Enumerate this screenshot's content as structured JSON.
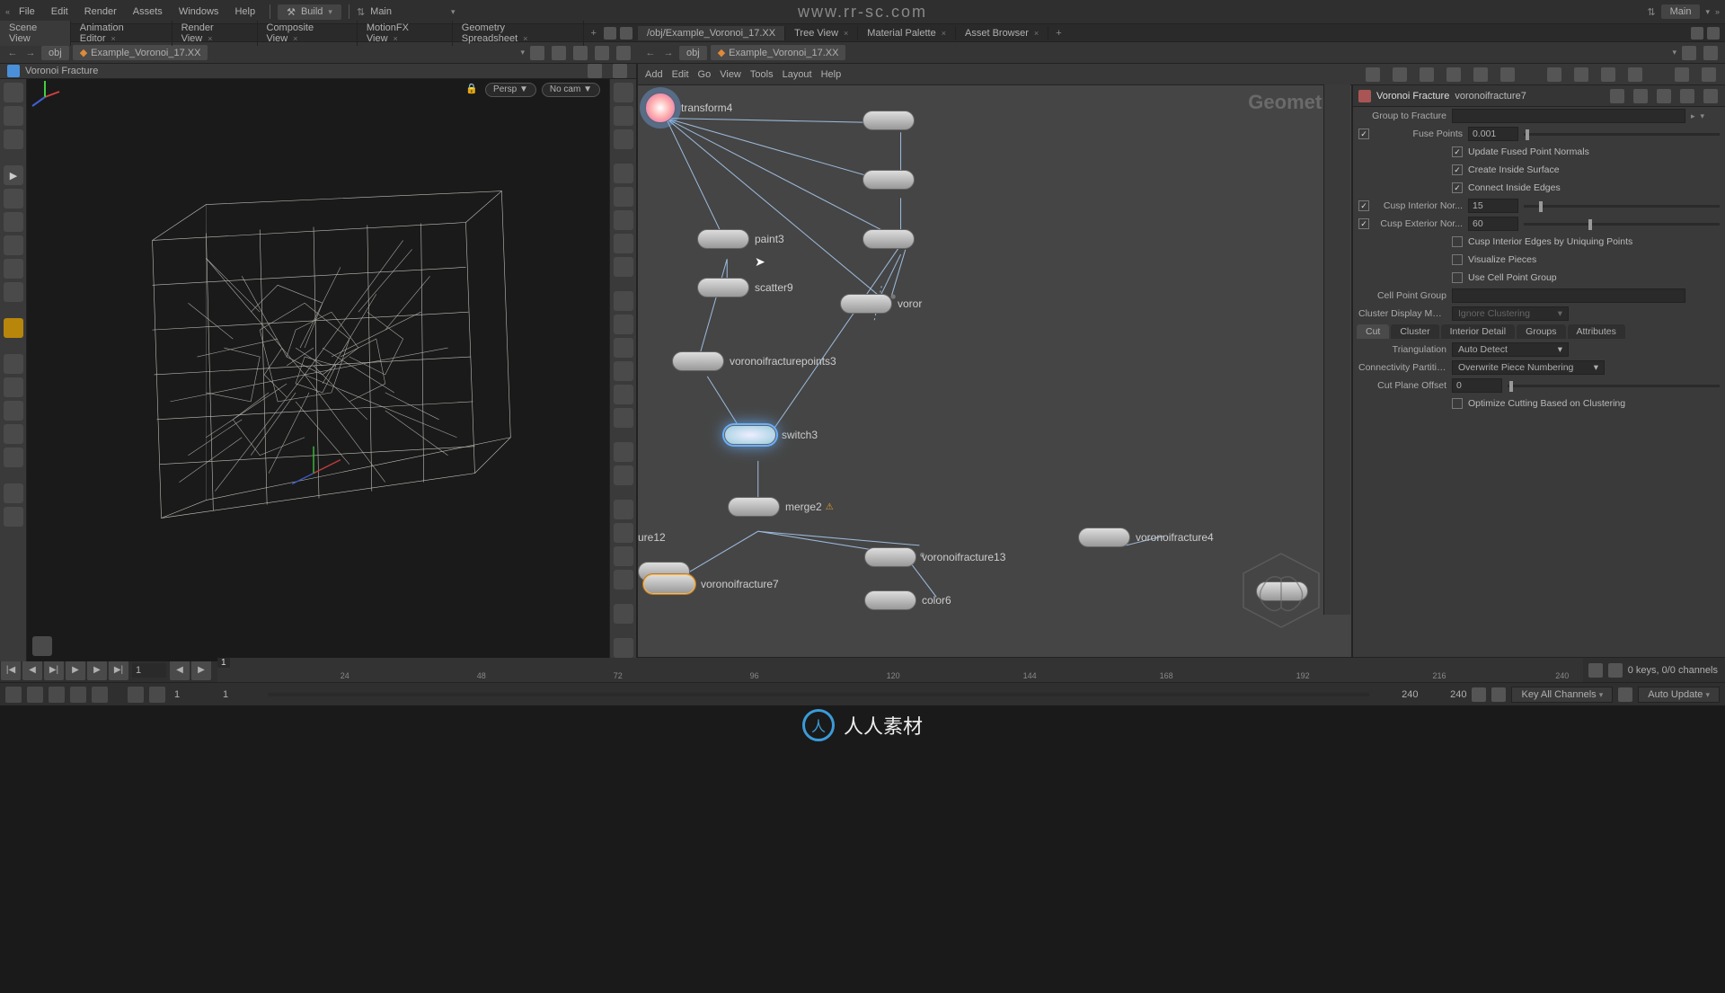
{
  "watermark": "www.rr-sc.com",
  "menubar": {
    "items": [
      "File",
      "Edit",
      "Render",
      "Assets",
      "Windows",
      "Help"
    ],
    "build": "Build",
    "main": "Main",
    "main_right": "Main"
  },
  "left_tabs": [
    "Scene View",
    "Animation Editor",
    "Render View",
    "Composite View",
    "MotionFX View",
    "Geometry Spreadsheet"
  ],
  "right_tabs": [
    "/obj/Example_Voronoi_17.XX",
    "Tree View",
    "Material Palette",
    "Asset Browser"
  ],
  "left_path": {
    "obj": "obj",
    "scene": "Example_Voronoi_17.XX"
  },
  "right_path": {
    "obj": "obj",
    "scene": "Example_Voronoi_17.XX"
  },
  "viewport": {
    "title": "Voronoi Fracture",
    "persp": "Persp ▼",
    "cam": "No cam ▼"
  },
  "net_menu": [
    "Add",
    "Edit",
    "Go",
    "View",
    "Tools",
    "Layout",
    "Help"
  ],
  "geometry_label": "Geometry",
  "nodes": {
    "transform4": "transform4",
    "paint3": "paint3",
    "scatter9": "scatter9",
    "voronoifracturepoints3": "voronoifracturepoints3",
    "switch3": "switch3",
    "merge2": "merge2",
    "ure12": "ure12",
    "voronoifracture7": "voronoifracture7",
    "voronoifracture13": "voronoifracture13",
    "color6": "color6",
    "voronoifracture4": "voronoifracture4",
    "voro_right": "voror"
  },
  "param": {
    "type": "Voronoi Fracture",
    "node": "voronoifracture7",
    "group_to_fracture": "Group to Fracture",
    "fuse_points": "Fuse Points",
    "fuse_points_val": "0.001",
    "update_fused": "Update Fused Point Normals",
    "create_inside": "Create Inside Surface",
    "connect_inside": "Connect Inside Edges",
    "cusp_int": "Cusp Interior Nor...",
    "cusp_int_val": "15",
    "cusp_ext": "Cusp Exterior Nor...",
    "cusp_ext_val": "60",
    "cusp_uniq": "Cusp Interior Edges by Uniquing Points",
    "vis_pieces": "Visualize Pieces",
    "use_cell": "Use Cell Point Group",
    "cell_group": "Cell Point Group",
    "cluster_disp": "Cluster Display Mode",
    "cluster_disp_val": "Ignore Clustering",
    "tabs": [
      "Cut",
      "Cluster",
      "Interior Detail",
      "Groups",
      "Attributes"
    ],
    "triangulation": "Triangulation",
    "triangulation_val": "Auto Detect",
    "conn_part": "Connectivity Partition",
    "conn_part_val": "Overwrite Piece Numbering",
    "cut_plane": "Cut Plane Offset",
    "cut_plane_val": "0",
    "optimize": "Optimize Cutting Based on Clustering"
  },
  "timeline": {
    "cur_frame": "1",
    "ticks": [
      "24",
      "48",
      "72",
      "96",
      "120",
      "144",
      "168",
      "192",
      "216",
      "240"
    ],
    "keys_info": "0 keys, 0/0 channels",
    "start": "1",
    "start2": "1",
    "end": "240",
    "end2": "240",
    "key_all": "Key All Channels",
    "auto_update": "Auto Update"
  },
  "footer_text": "人人素材"
}
